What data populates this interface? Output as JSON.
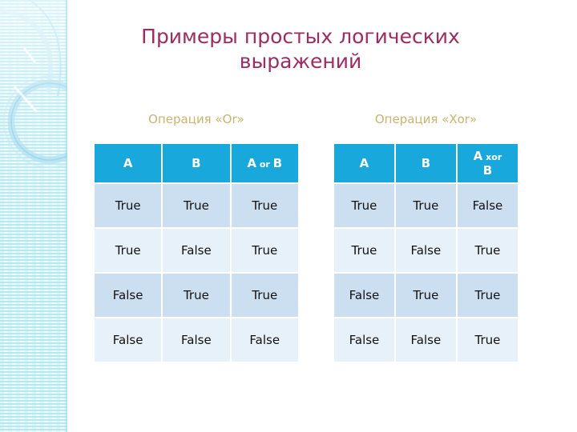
{
  "slide": {
    "title": "Примеры простых логических выражений",
    "title_color": "#9c2d62",
    "background_color": "#ffffff"
  },
  "decoration": {
    "band_name": "left-decorative-band",
    "band_color": "#d4f1f6",
    "accent_color": "#a8dcef"
  },
  "tables": [
    {
      "caption": "Операция «Or»",
      "caption_color": "#c9b472",
      "header_color": "#19a8dc",
      "row_dark_color": "#cbdff0",
      "row_light_color": "#e7f1fa",
      "headers": {
        "a": "A",
        "b": "B",
        "result_prefix": "A",
        "result_op": "or",
        "result_suffix": "B"
      },
      "rows": [
        {
          "a": "True",
          "b": "True",
          "result": "True"
        },
        {
          "a": "True",
          "b": "False",
          "result": "True"
        },
        {
          "a": "False",
          "b": "True",
          "result": "True"
        },
        {
          "a": "False",
          "b": "False",
          "result": "False"
        }
      ]
    },
    {
      "caption": "Операция «Xor»",
      "caption_color": "#c9b472",
      "header_color": "#19a8dc",
      "row_dark_color": "#cbdff0",
      "row_light_color": "#e7f1fa",
      "headers": {
        "a": "A",
        "b": "B",
        "result_prefix": "A",
        "result_op": "xor",
        "result_suffix": "B"
      },
      "rows": [
        {
          "a": "True",
          "b": "True",
          "result": "False"
        },
        {
          "a": "True",
          "b": "False",
          "result": "True"
        },
        {
          "a": "False",
          "b": "True",
          "result": "True"
        },
        {
          "a": "False",
          "b": "False",
          "result": "True"
        }
      ]
    }
  ]
}
